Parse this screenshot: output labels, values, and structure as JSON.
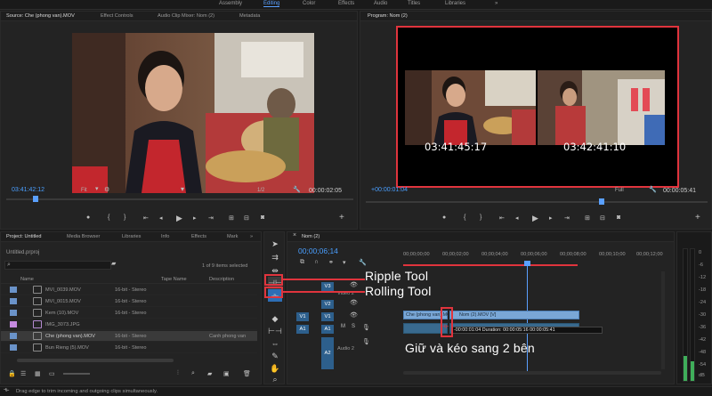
{
  "workspaces": [
    "Assembly",
    "Editing",
    "Color",
    "Effects",
    "Audio",
    "Titles",
    "Libraries"
  ],
  "source_monitor": {
    "tabs": [
      "Source: Che (phong van).MOV",
      "Effect Controls",
      "Audio Clip Mixer: Nom (2)",
      "Metadata"
    ],
    "timecode_in": "03:41:42:12",
    "fit": "Fit",
    "ratio": "1/2",
    "timecode_out": "00:00:02:05"
  },
  "program_monitor": {
    "tab": "Program: Nom (2)",
    "timecode_in": "+00:00:01:04",
    "fit": "Full",
    "timecode_out": "00:00:05:41",
    "left_frame_tc": "03:41:45:17",
    "right_frame_tc": "03:42:41:10"
  },
  "project": {
    "tabs": [
      "Project: Untitled",
      "Media Browser",
      "Libraries",
      "Info",
      "Effects",
      "Mark"
    ],
    "file": "Untitled.prproj",
    "selection": "1 of 9 items selected",
    "columns": [
      "Name",
      "Tape Name",
      "Description"
    ],
    "items": [
      {
        "name": "MVI_0039.MOV",
        "fps": "16-bit - Stereo",
        "desc": "",
        "color": "#6a93c9"
      },
      {
        "name": "MVI_0015.MOV",
        "fps": "16-bit - Stereo",
        "desc": "",
        "color": "#6a93c9"
      },
      {
        "name": "Kem (10).MOV",
        "fps": "16-bit - Stereo",
        "desc": "",
        "color": "#6a93c9"
      },
      {
        "name": "IMG_3073.JPG",
        "fps": "",
        "desc": "",
        "color": "#c58adf"
      },
      {
        "name": "Che (phong van).MOV",
        "fps": "16-bit - Stereo",
        "desc": "Canh phong van",
        "color": "#6a93c9"
      },
      {
        "name": "Bun Rieng (5).MOV",
        "fps": "16-bit - Stereo",
        "desc": "",
        "color": "#6a93c9"
      }
    ]
  },
  "timeline": {
    "tab": "Nom (2)",
    "timecode": "00;00;06;14",
    "ruler": [
      "00;00;00;00",
      "00;00;02;00",
      "00;00;04;00",
      "00;00;06;00",
      "00;00;08;00",
      "00;00;10;00",
      "00;00;12;00"
    ],
    "tracks_video": [
      "V3",
      "V2",
      "V1"
    ],
    "tracks_audio": [
      "A1",
      "A2"
    ],
    "clip_a": "Che (phong van).MOV [V]",
    "clip_b": "Nom (2).MOV [V]",
    "duration_tip": "-00:00:01:04 Duration: 00:00:05:16 00:00:05:41",
    "track_label_v2": "Video 2",
    "track_label_a2": "Audio 2"
  },
  "annotations": {
    "ripple": "Ripple Tool",
    "rolling": "Rolling Tool",
    "hint": "Giữ và kéo sang 2 bên"
  },
  "status": "Drag edge to trim incoming and outgoing clips simultaneously.",
  "meter_scale": [
    "0",
    "-6",
    "-12",
    "-18",
    "-24",
    "-30",
    "-36",
    "-42",
    "-48",
    "-54",
    "dB"
  ]
}
